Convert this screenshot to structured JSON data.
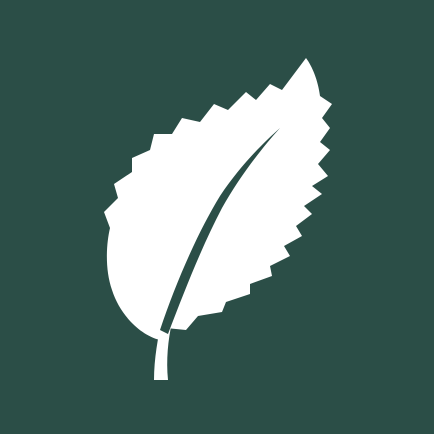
{
  "icon": {
    "name": "leaf-icon",
    "background_color": "#2B4E47",
    "foreground_color": "#FFFFFF"
  }
}
